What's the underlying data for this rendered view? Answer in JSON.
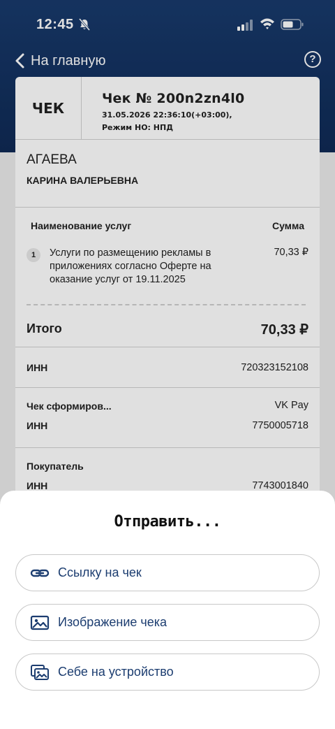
{
  "status": {
    "time": "12:45"
  },
  "nav": {
    "back_label": "На главную",
    "help_label": "?"
  },
  "receipt": {
    "label": "ЧЕК",
    "number": "Чек № 200n2zn4l0",
    "datetime": "31.05.2026 22:36:10(+03:00),",
    "mode": "Режим НО: НПД",
    "seller_surname": "АГАЕВА",
    "seller_name": "КАРИНА ВАЛЕРЬЕВНА",
    "services_header": "Наименование услуг",
    "sum_header": "Сумма",
    "items": [
      {
        "index": "1",
        "name": "Услуги по размещению рекламы в приложениях согласно Оферте на оказание услуг от 19.11.2025",
        "price": "70,33 ₽"
      }
    ],
    "total_label": "Итого",
    "total_value": "70,33 ₽",
    "inn_label": "ИНН",
    "inn_value": "720323152108",
    "formed_label": "Чек сформиров...",
    "formed_value": "VK Pay",
    "formed_inn_label": "ИНН",
    "formed_inn_value": "7750005718",
    "buyer_label": "Покупатель",
    "buyer_inn_label": "ИНН",
    "buyer_inn_value": "7743001840"
  },
  "sheet": {
    "title": "Отправить...",
    "options": [
      {
        "label": "Ссылку на чек",
        "icon": "link-icon"
      },
      {
        "label": "Изображение чека",
        "icon": "image-icon"
      },
      {
        "label": "Себе на устройство",
        "icon": "gallery-icon"
      }
    ]
  },
  "colors": {
    "header": "#183a6c",
    "accent_text": "#1c3d70"
  }
}
